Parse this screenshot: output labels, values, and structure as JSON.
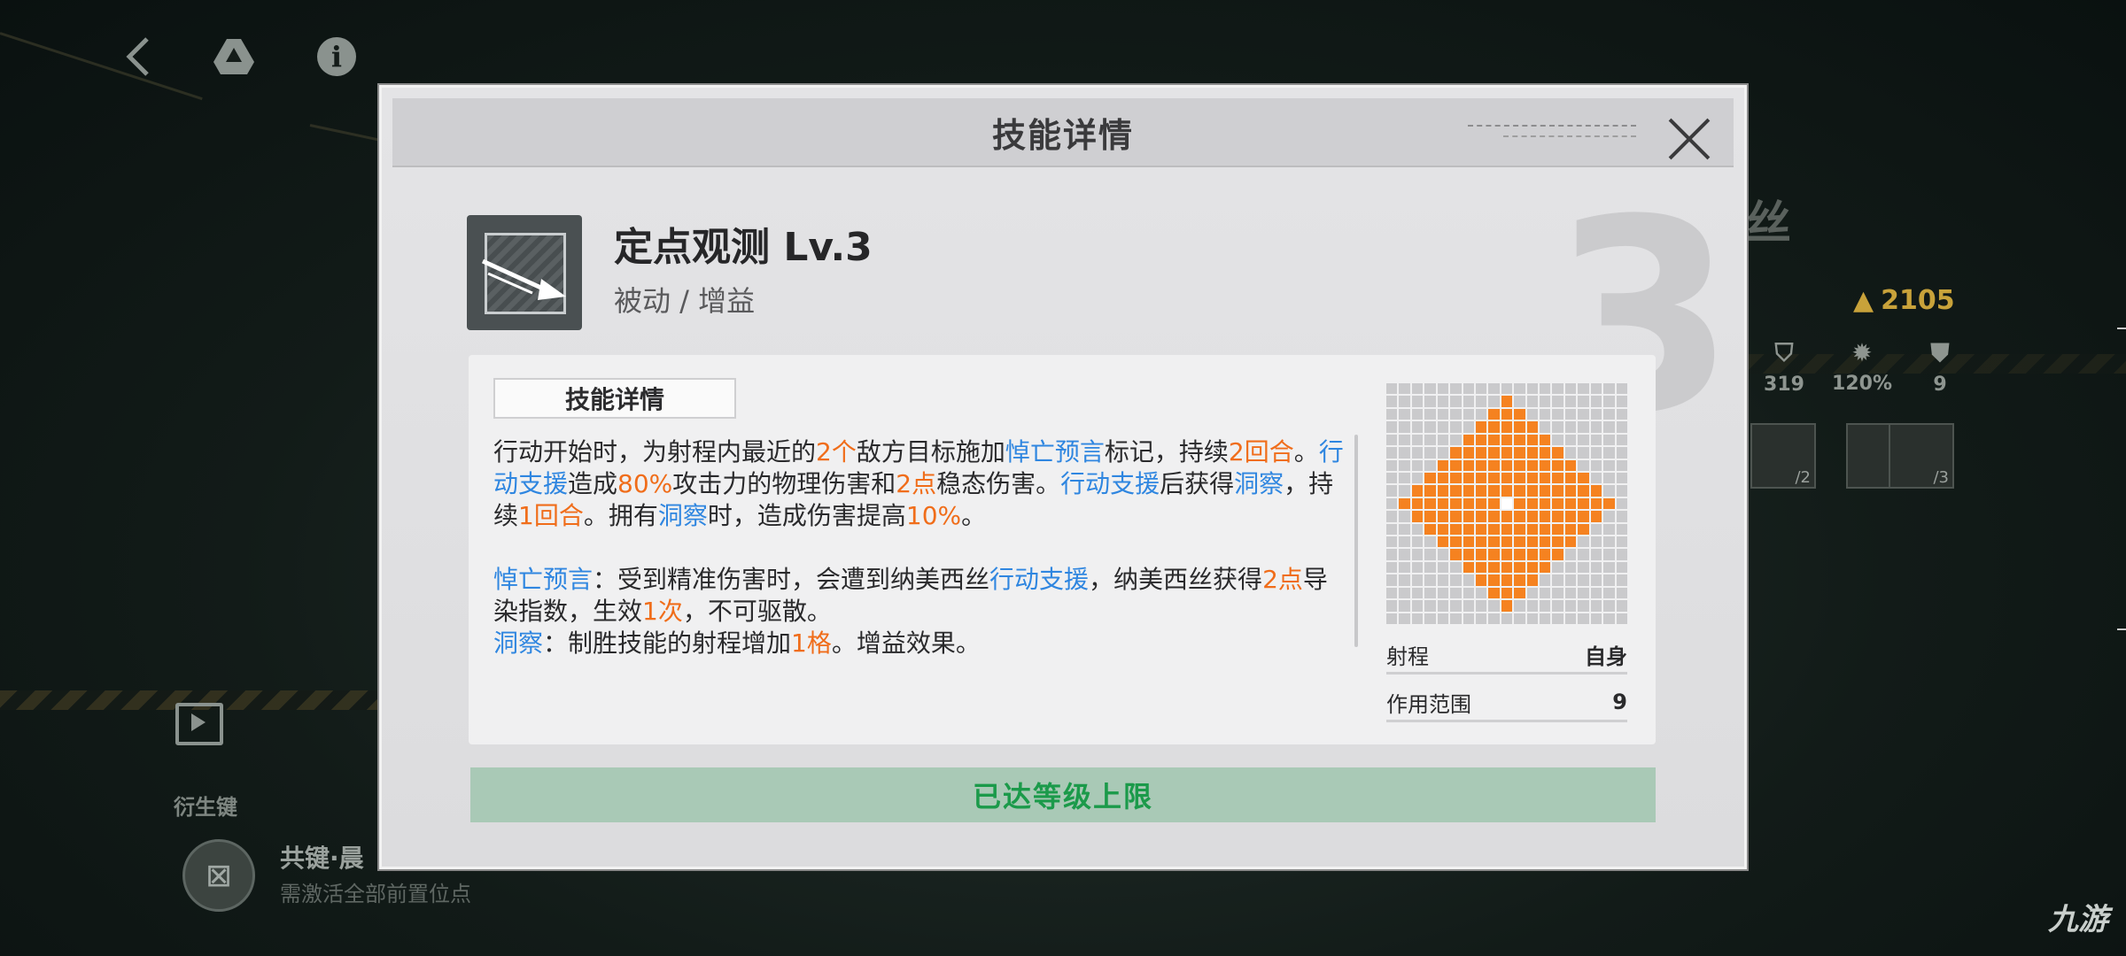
{
  "background": {
    "title_fragment": "丝",
    "gold": "2105",
    "stats": [
      {
        "icon": "shield-icon",
        "value": "319"
      },
      {
        "icon": "gear-icon",
        "value": "120%"
      },
      {
        "icon": "badge-icon",
        "value": "9"
      }
    ],
    "skill_slots": [
      "/2",
      "/3",
      "/3"
    ],
    "derive_label": "衍生键",
    "key_name": "共键·晨",
    "key_desc": "需激活全部前置位点",
    "watermark": "九游"
  },
  "modal": {
    "title": "技能详情",
    "big_level": "3",
    "skill_name": "定点观测 Lv.3",
    "skill_type": "被动 / 增益",
    "tab_label": "技能详情",
    "description": {
      "p1": [
        {
          "t": "行动开始时，为射程内最近的",
          "c": ""
        },
        {
          "t": "2个",
          "c": "o"
        },
        {
          "t": "敌方目标施加",
          "c": ""
        },
        {
          "t": "悼亡预言",
          "c": "b"
        },
        {
          "t": "标记，持续",
          "c": ""
        },
        {
          "t": "2回合",
          "c": "o"
        },
        {
          "t": "。",
          "c": ""
        },
        {
          "t": "行动支援",
          "c": "b"
        },
        {
          "t": "造成",
          "c": ""
        },
        {
          "t": "80%",
          "c": "o"
        },
        {
          "t": "攻击力的物理伤害和",
          "c": ""
        },
        {
          "t": "2点",
          "c": "o"
        },
        {
          "t": "稳态伤害。",
          "c": ""
        },
        {
          "t": "行动支援",
          "c": "b"
        },
        {
          "t": "后获得",
          "c": ""
        },
        {
          "t": "洞察",
          "c": "b"
        },
        {
          "t": "，持续",
          "c": ""
        },
        {
          "t": "1回合",
          "c": "o"
        },
        {
          "t": "。拥有",
          "c": ""
        },
        {
          "t": "洞察",
          "c": "b"
        },
        {
          "t": "时，造成伤害提高",
          "c": ""
        },
        {
          "t": "10%",
          "c": "o"
        },
        {
          "t": "。",
          "c": ""
        }
      ],
      "p2": [
        {
          "t": "悼亡预言",
          "c": "b"
        },
        {
          "t": "：受到精准伤害时，会遭到纳美西丝",
          "c": ""
        },
        {
          "t": "行动支援",
          "c": "b"
        },
        {
          "t": "，纳美西丝获得",
          "c": ""
        },
        {
          "t": "2点",
          "c": "o"
        },
        {
          "t": "导染指数，生效",
          "c": ""
        },
        {
          "t": "1次",
          "c": "o"
        },
        {
          "t": "，不可驱散。",
          "c": ""
        }
      ],
      "p3": [
        {
          "t": "洞察",
          "c": "b"
        },
        {
          "t": "：制胜技能的射程增加",
          "c": ""
        },
        {
          "t": "1格",
          "c": "o"
        },
        {
          "t": "。增益效果。",
          "c": ""
        }
      ]
    },
    "range": {
      "grid_size": 19,
      "radius": 8
    },
    "range_label": "射程",
    "range_value": "自身",
    "area_label": "作用范围",
    "area_value": "9",
    "max_level_text": "已达等级上限",
    "colors": {
      "accent_orange": "#f06d1a",
      "keyword_blue": "#2f86e0",
      "max_green": "#1b9a4a"
    }
  }
}
